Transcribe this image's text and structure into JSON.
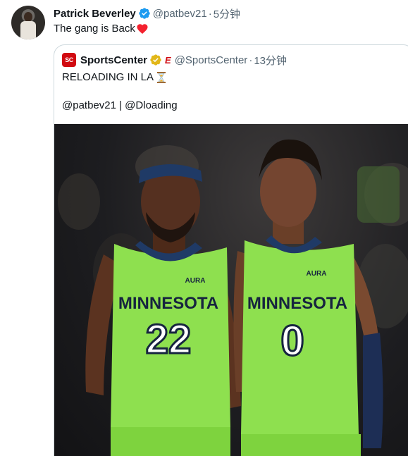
{
  "tweet": {
    "author_name": "Patrick Beverley",
    "handle": "@patbev21",
    "separator": "·",
    "time": "5分钟",
    "text": "The gang is Back"
  },
  "quote": {
    "author_name": "SportsCenter",
    "handle": "@SportsCenter",
    "separator": "·",
    "time": "13分钟",
    "text_line1": "RELOADING IN LA",
    "text_line2": "@patbev21 | @Dloading",
    "logo_text": "SC",
    "photo": {
      "left_jersey_text": "MINNESOTA",
      "left_number": "22",
      "right_jersey_text": "MINNESOTA",
      "right_number": "0",
      "sponsor": "AURA",
      "jersey_color": "#8ee04f"
    }
  },
  "colors": {
    "verified_blue": "#1d9bf0",
    "gold_badge": "#e2b719",
    "espn_red": "#d10a11",
    "heart": "#f4212e",
    "secondary_text": "#536471"
  },
  "icons": [
    "verified-icon",
    "heart-emoji",
    "gold-verified-icon",
    "espn-icon",
    "hourglass-emoji"
  ]
}
